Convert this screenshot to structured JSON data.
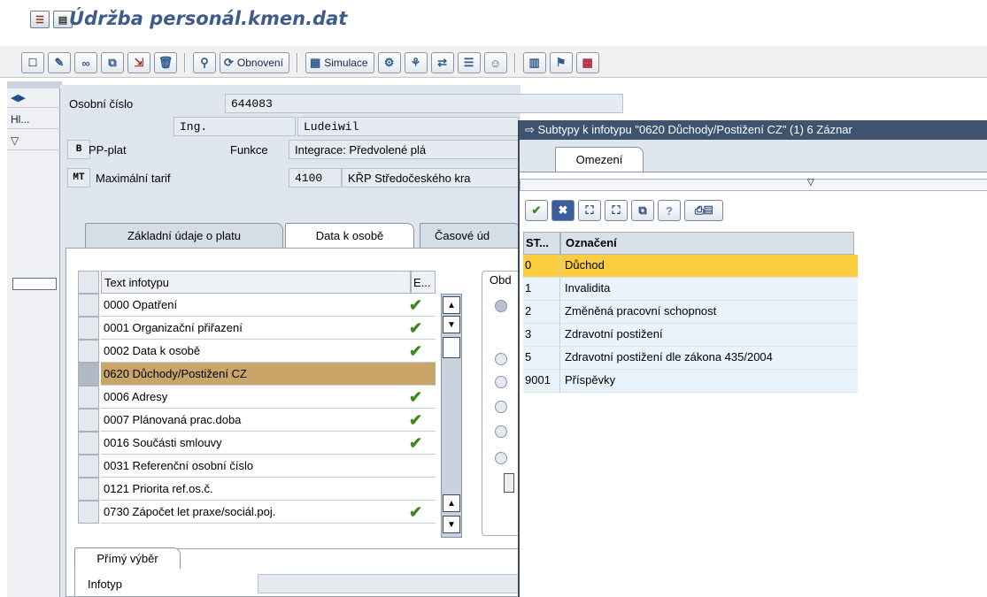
{
  "title": "Údržba personál.kmen.dat",
  "toolbar": {
    "obnoveni": "Obnovení",
    "simulace": "Simulace"
  },
  "leftnav": {
    "hl": "Hl..."
  },
  "header": {
    "osobni_cislo_label": "Osobní číslo",
    "osobni_cislo_value": "644083",
    "titul": "Ing.",
    "jmeno": "Ludeiwil",
    "b_code": "B",
    "b_label": "PP-plat",
    "funkce_label": "Funkce",
    "funkce_value": "Integrace: Předvolené plá",
    "mt_code": "MT",
    "mt_label": "Maximální tarif",
    "tarif_code": "4100",
    "tarif_value": "KŘP Středočeského kra"
  },
  "tabs": [
    {
      "label": "Základní údaje o platu"
    },
    {
      "label": "Data k osobě"
    },
    {
      "label": "Časové úd"
    }
  ],
  "infotable": {
    "col_text": "Text infotypu",
    "col_e": "E...",
    "rows": [
      {
        "text": "0000 Opatření",
        "checked": true
      },
      {
        "text": "0001 Organizační přiřazení",
        "checked": true
      },
      {
        "text": "0002 Data k osobě",
        "checked": true
      },
      {
        "text": "0620 Důchody/Postižení CZ",
        "checked": false,
        "selected": true
      },
      {
        "text": "0006 Adresy",
        "checked": true
      },
      {
        "text": "0007 Plánovaná prac.doba",
        "checked": true
      },
      {
        "text": "0016 Součásti smlouvy",
        "checked": true
      },
      {
        "text": "0031 Referenční osobní číslo",
        "checked": false
      },
      {
        "text": "0121 Priorita ref.os.č.",
        "checked": false
      },
      {
        "text": "0730 Zápočet let praxe/sociál.poj.",
        "checked": true
      }
    ]
  },
  "obd_label": "Obd",
  "primy": {
    "tab": "Přímý výběr",
    "infotyp_label": "Infotyp"
  },
  "popup": {
    "title": "Subtypy k infotypu \"0620 Důchody/Postižení CZ\" (1)   6 Záznar",
    "tab": "Omezení",
    "col_st": "ST...",
    "col_oznaceni": "Označení",
    "rows": [
      {
        "st": "0",
        "text": "Důchod",
        "selected": true
      },
      {
        "st": "1",
        "text": "Invalidita"
      },
      {
        "st": "2",
        "text": "Změněná pracovní schopnost"
      },
      {
        "st": "3",
        "text": "Zdravotní postižení"
      },
      {
        "st": "5",
        "text": "Zdravotní postižení dle zákona 435/2004"
      },
      {
        "st": "9001",
        "text": "Příspěvky"
      }
    ]
  }
}
